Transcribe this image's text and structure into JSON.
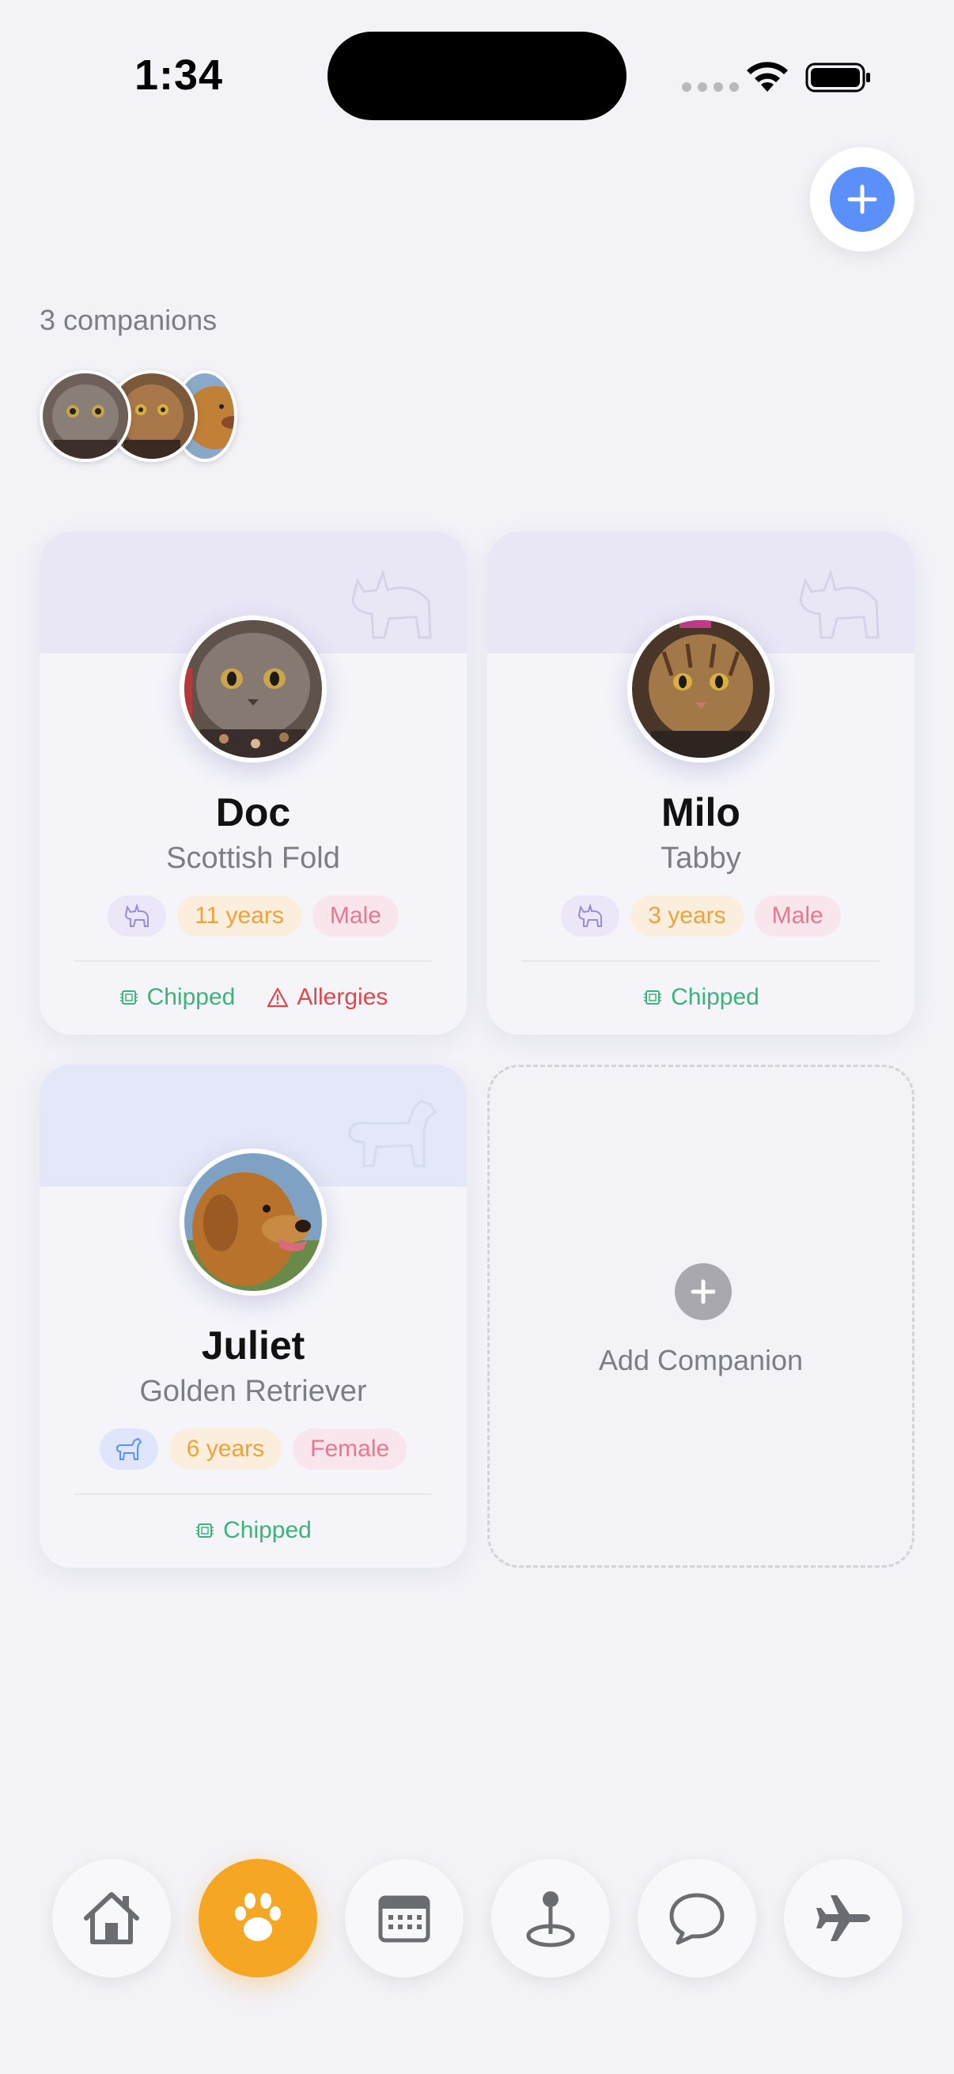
{
  "status_bar": {
    "time": "1:34"
  },
  "header": {
    "companion_count": "3 companions",
    "avatars": [
      "Doc",
      "Milo",
      "Juliet"
    ]
  },
  "colors": {
    "accent_blue": "#5b8ff9",
    "active_tab": "#f5a623",
    "chipped_green": "#3cb37a",
    "allergy_red": "#e0474c",
    "age_orange": "#f0a23a",
    "sex_pink": "#e8778f"
  },
  "companions": [
    {
      "name": "Doc",
      "breed": "Scottish Fold",
      "species_icon": "cat-icon",
      "age": "11 years",
      "sex": "Male",
      "tags": [
        "Chipped",
        "Allergies"
      ]
    },
    {
      "name": "Milo",
      "breed": "Tabby",
      "species_icon": "cat-icon",
      "age": "3 years",
      "sex": "Male",
      "tags": [
        "Chipped"
      ]
    },
    {
      "name": "Juliet",
      "breed": "Golden Retriever",
      "species_icon": "dog-icon",
      "age": "6 years",
      "sex": "Female",
      "tags": [
        "Chipped"
      ]
    }
  ],
  "add_card": {
    "label": "Add Companion"
  },
  "tab_bar": {
    "tabs": [
      {
        "icon": "home-icon",
        "active": false
      },
      {
        "icon": "paw-icon",
        "active": true
      },
      {
        "icon": "calendar-icon",
        "active": false
      },
      {
        "icon": "map-pin-icon",
        "active": false
      },
      {
        "icon": "chat-icon",
        "active": false
      },
      {
        "icon": "airplane-icon",
        "active": false
      }
    ]
  }
}
